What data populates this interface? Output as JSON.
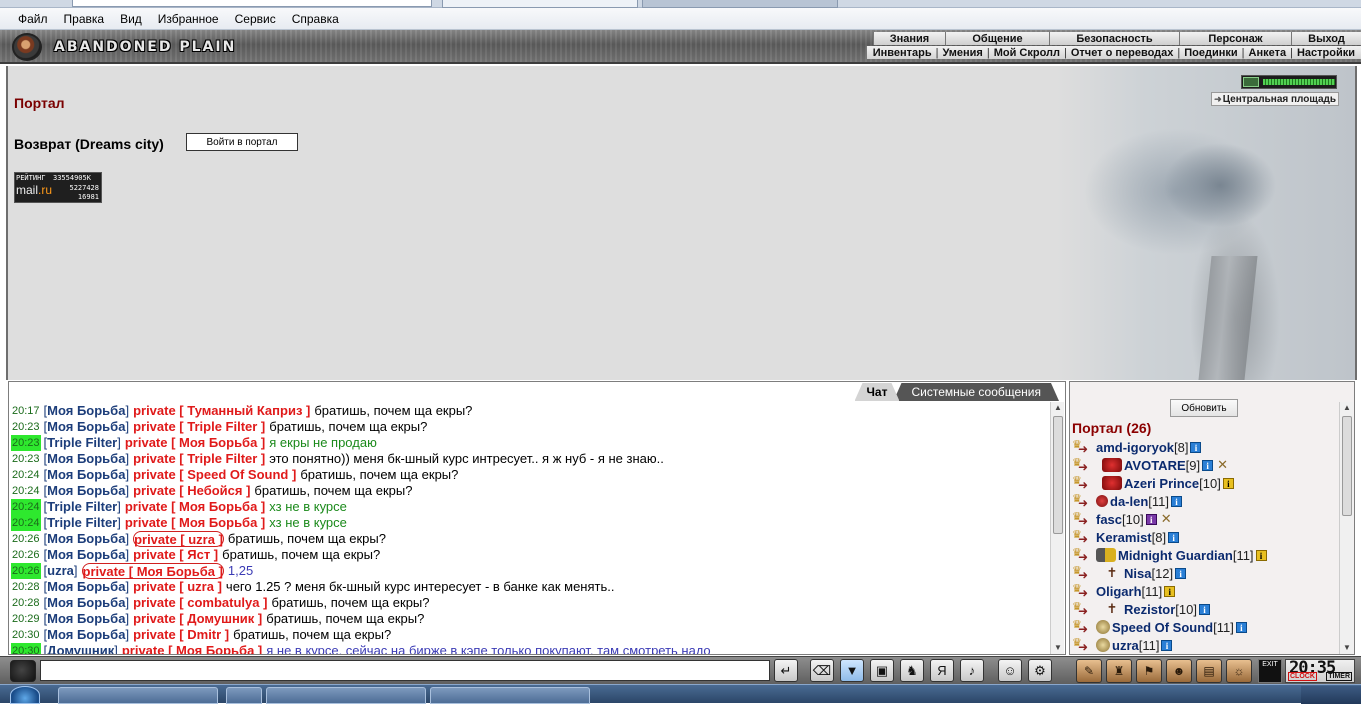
{
  "menubar": [
    "Файл",
    "Правка",
    "Вид",
    "Избранное",
    "Сервис",
    "Справка"
  ],
  "header": {
    "logo": "ABANDONED PLAIN",
    "topnav": [
      "Знания",
      "Общение",
      "Безопасность",
      "Персонаж",
      "Выход"
    ],
    "subnav": [
      "Инвентарь",
      "Умения",
      "Мой Скролл",
      "Отчет о переводах",
      "Поединки",
      "Анкета",
      "Настройки"
    ]
  },
  "main": {
    "title": "Портал",
    "return_label": "Возврат (Dreams city)",
    "enter_button": "Войти в портал",
    "location": "Центральная площадь",
    "hp_level": 1.0,
    "counter": {
      "label": "РЕЙТИНГ",
      "v1": "33554905K",
      "brand": "mail",
      "brand_suffix": ".ru",
      "v2": "5227428",
      "v3": "16981"
    }
  },
  "chat": {
    "tabs": [
      "Чат",
      "Системные сообщения"
    ],
    "lines": [
      {
        "time": "20:17",
        "hl": false,
        "nick": "Моя Борьба",
        "priv": "private [ Туманный Каприз ]",
        "msg": "братишь, почем ща екры?",
        "style": "",
        "circled": false
      },
      {
        "time": "20:23",
        "hl": false,
        "nick": "Моя Борьба",
        "priv": "private [ Triple Filter ]",
        "msg": "братишь, почем ща екры?",
        "style": "",
        "circled": false
      },
      {
        "time": "20:23",
        "hl": true,
        "nick": "Triple Filter",
        "priv": "private [ Моя Борьба ]",
        "msg": "я екры не продаю",
        "style": "green",
        "circled": false
      },
      {
        "time": "20:23",
        "hl": false,
        "nick": "Моя Борьба",
        "priv": "private [ Triple Filter ]",
        "msg": "это понятно)) меня бк-шный курс интресует.. я ж нуб - я не знаю..",
        "style": "",
        "circled": false
      },
      {
        "time": "20:24",
        "hl": false,
        "nick": "Моя Борьба",
        "priv": "private [ Speed Of Sound ]",
        "msg": "братишь, почем ща екры?",
        "style": "",
        "circled": false
      },
      {
        "time": "20:24",
        "hl": false,
        "nick": "Моя Борьба",
        "priv": "private [ Небойся ]",
        "msg": "братишь, почем ща екры?",
        "style": "",
        "circled": false
      },
      {
        "time": "20:24",
        "hl": true,
        "nick": "Triple Filter",
        "priv": "private [ Моя Борьба ]",
        "msg": "хз не в курсе",
        "style": "green",
        "circled": false
      },
      {
        "time": "20:24",
        "hl": true,
        "nick": "Triple Filter",
        "priv": "private [ Моя Борьба ]",
        "msg": "хз не в курсе",
        "style": "green",
        "circled": false
      },
      {
        "time": "20:26",
        "hl": false,
        "nick": "Моя Борьба",
        "priv": "private [ uzra ]",
        "msg": "братишь, почем ща екры?",
        "style": "",
        "circled": true
      },
      {
        "time": "20:26",
        "hl": false,
        "nick": "Моя Борьба",
        "priv": "private [ Яст ]",
        "msg": "братишь, почем ща екры?",
        "style": "",
        "circled": false
      },
      {
        "time": "20:26",
        "hl": true,
        "nick": "uzra",
        "priv": "private [ Моя Борьба ]",
        "msg": "1,25",
        "style": "blue",
        "circled": true
      },
      {
        "time": "20:28",
        "hl": false,
        "nick": "Моя Борьба",
        "priv": "private [ uzra ]",
        "msg": "чего 1.25 ? меня бк-шный курс интересует - в банке как менять..",
        "style": "",
        "circled": false
      },
      {
        "time": "20:28",
        "hl": false,
        "nick": "Моя Борьба",
        "priv": "private [ combatulya ]",
        "msg": "братишь, почем ща екры?",
        "style": "",
        "circled": false
      },
      {
        "time": "20:29",
        "hl": false,
        "nick": "Моя Борьба",
        "priv": "private [ Домушник ]",
        "msg": "братишь, почем ща екры?",
        "style": "",
        "circled": false
      },
      {
        "time": "20:30",
        "hl": false,
        "nick": "Моя Борьба",
        "priv": "private [ Dmitr ]",
        "msg": "братишь, почем ща екры?",
        "style": "",
        "circled": false
      },
      {
        "time": "20:30",
        "hl": true,
        "nick": "Домушник",
        "priv": "private [ Моя Борьба ]",
        "msg": "я не в курсе, сейчас на бирже в кэпе только покупают, там смотреть надо",
        "style": "blue",
        "circled": false
      }
    ]
  },
  "players": {
    "refresh_button": "Обновить",
    "title": "Портал (26)",
    "list": [
      {
        "name": "amd-igoryok",
        "level": "[8]",
        "emblem": "",
        "info": "blue",
        "swords": false,
        "indent": false
      },
      {
        "name": "AVOTARE",
        "level": "[9]",
        "emblem": "red",
        "info": "blue",
        "swords": true,
        "indent": true
      },
      {
        "name": "Azeri Prince",
        "level": "[10]",
        "emblem": "red",
        "info": "yellow",
        "swords": false,
        "indent": true
      },
      {
        "name": "da-len",
        "level": "[11]",
        "emblem": "dot",
        "info": "blue",
        "swords": false,
        "indent": false
      },
      {
        "name": "fasc",
        "level": "[10]",
        "emblem": "",
        "info": "purple",
        "swords": true,
        "indent": false
      },
      {
        "name": "Keramist",
        "level": "[8]",
        "emblem": "",
        "info": "blue",
        "swords": false,
        "indent": false
      },
      {
        "name": "Midnight Guardian",
        "level": "[11]",
        "emblem": "mid",
        "info": "yellow",
        "swords": false,
        "indent": false
      },
      {
        "name": "Nisa",
        "level": "[12]",
        "emblem": "cross",
        "info": "blue",
        "swords": false,
        "indent": true
      },
      {
        "name": "Oligarh",
        "level": "[11]",
        "emblem": "",
        "info": "yellow",
        "swords": false,
        "indent": false
      },
      {
        "name": "Rezistor",
        "level": "[10]",
        "emblem": "cross",
        "info": "blue",
        "swords": false,
        "indent": true
      },
      {
        "name": "Speed Of Sound",
        "level": "[11]",
        "emblem": "skull",
        "info": "blue",
        "swords": false,
        "indent": false
      },
      {
        "name": "uzra",
        "level": "[11]",
        "emblem": "skull",
        "info": "blue",
        "swords": false,
        "indent": false
      }
    ]
  },
  "toolbar": {
    "chat_input_value": "",
    "exit_label": "EXIT",
    "clock_time": "20:35",
    "clock_label": "CLOCK",
    "timer_label": "TIMER"
  }
}
